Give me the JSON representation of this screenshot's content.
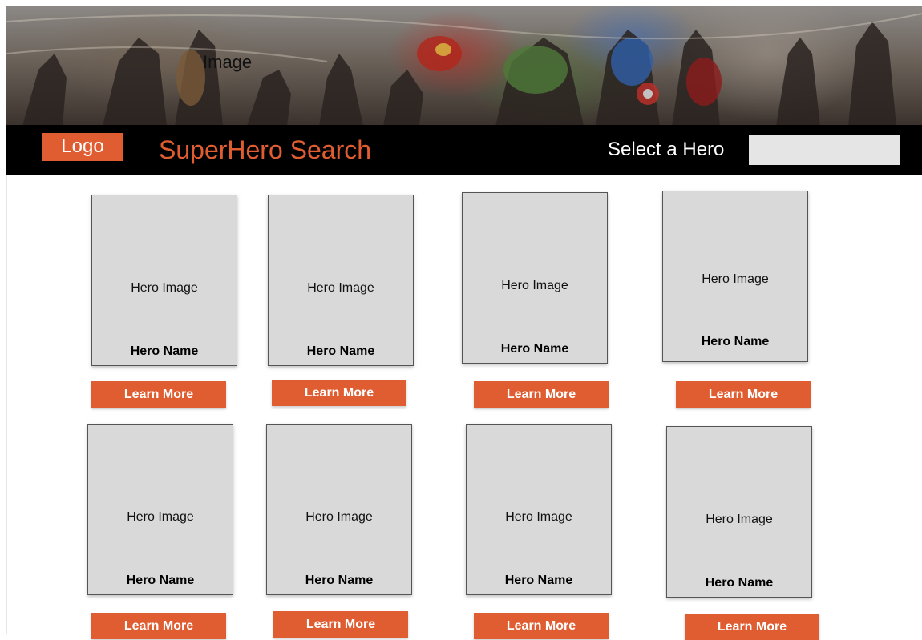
{
  "banner": {
    "label": "Image"
  },
  "header": {
    "logo": "Logo",
    "title": "SuperHero Search",
    "select_label": "Select a Hero",
    "select_value": ""
  },
  "cards": [
    {
      "image_label": "Hero Image",
      "name": "Hero Name",
      "button": "Learn More"
    },
    {
      "image_label": "Hero Image",
      "name": "Hero Name",
      "button": "Learn More"
    },
    {
      "image_label": "Hero Image",
      "name": "Hero Name",
      "button": "Learn More"
    },
    {
      "image_label": "Hero Image",
      "name": "Hero Name",
      "button": "Learn More"
    },
    {
      "image_label": "Hero Image",
      "name": "Hero Name",
      "button": "Learn More"
    },
    {
      "image_label": "Hero Image",
      "name": "Hero Name",
      "button": "Learn More"
    },
    {
      "image_label": "Hero Image",
      "name": "Hero Name",
      "button": "Learn More"
    },
    {
      "image_label": "Hero Image",
      "name": "Hero Name",
      "button": "Learn More"
    }
  ],
  "colors": {
    "accent": "#e05d31",
    "header_bg": "#000000",
    "card_bg": "#d9d9d9",
    "select_bg": "#e5e5e5"
  }
}
